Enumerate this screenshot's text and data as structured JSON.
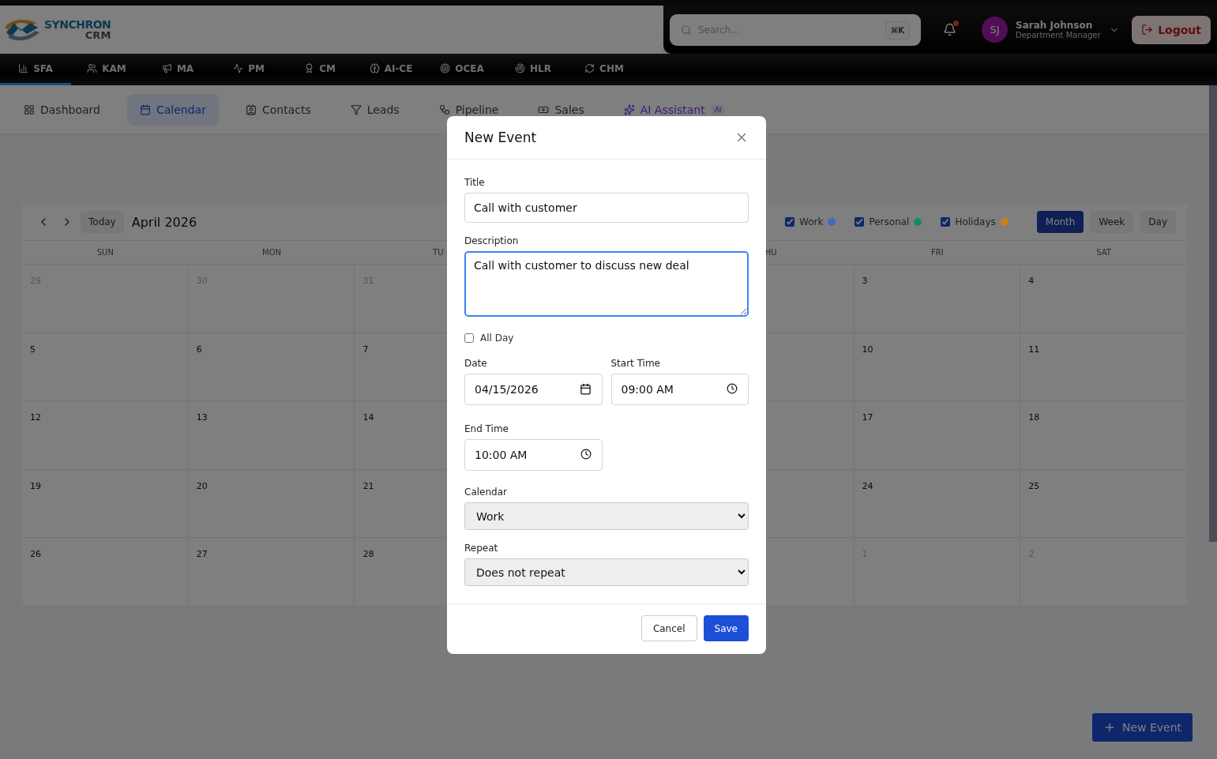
{
  "header": {
    "logo": {
      "name": "SYNCHRON",
      "sub": "CRM"
    },
    "search": {
      "placeholder": "Search...",
      "shortcut": "⌘K"
    },
    "notifications": {
      "unread": true
    },
    "user": {
      "initials": "SJ",
      "name": "Sarah Johnson",
      "role": "Department Manager"
    },
    "logout": "Logout"
  },
  "modules": [
    {
      "label": "SFA",
      "selected": true
    },
    {
      "label": "KAM",
      "selected": false
    },
    {
      "label": "MA",
      "selected": false
    },
    {
      "label": "PM",
      "selected": false
    },
    {
      "label": "CM",
      "selected": false
    },
    {
      "label": "AI-CE",
      "selected": false
    },
    {
      "label": "OCEA",
      "selected": false
    },
    {
      "label": "HLR",
      "selected": false
    },
    {
      "label": "CHM",
      "selected": false
    }
  ],
  "tabs": [
    {
      "label": "Dashboard",
      "selected": false
    },
    {
      "label": "Calendar",
      "selected": true
    },
    {
      "label": "Contacts",
      "selected": false
    },
    {
      "label": "Leads",
      "selected": false
    },
    {
      "label": "Pipeline",
      "selected": false
    },
    {
      "label": "Sales",
      "selected": false
    },
    {
      "label": "AI Assistant",
      "selected": false,
      "badge": "AI"
    }
  ],
  "calendar": {
    "today": "Today",
    "month": "April 2026",
    "filters": [
      {
        "label": "Work",
        "checked": true,
        "color": "#3a6cc0"
      },
      {
        "label": "Personal",
        "checked": true,
        "color": "#1a8a5a"
      },
      {
        "label": "Holidays",
        "checked": true,
        "color": "#c8821a"
      }
    ],
    "views": [
      {
        "label": "Month",
        "selected": true
      },
      {
        "label": "Week",
        "selected": false
      },
      {
        "label": "Day",
        "selected": false
      }
    ],
    "columns": [
      "SUN",
      "MON",
      "TU",
      "HU",
      "FRI",
      "SAT"
    ],
    "weeks": [
      {
        "days": [
          {
            "day": "29",
            "muted": true
          },
          {
            "day": "30",
            "muted": true
          },
          {
            "day": "31",
            "muted": true
          },
          {
            "day": "3",
            "muted": false
          },
          {
            "day": "4",
            "muted": false
          }
        ]
      },
      {
        "days": [
          {
            "day": "5",
            "muted": false
          },
          {
            "day": "6",
            "muted": false
          },
          {
            "day": "7",
            "muted": false
          },
          {
            "day": "10",
            "muted": false
          },
          {
            "day": "11",
            "muted": false
          }
        ]
      },
      {
        "days": [
          {
            "day": "12",
            "muted": false
          },
          {
            "day": "13",
            "muted": false
          },
          {
            "day": "14",
            "muted": false
          },
          {
            "day": "17",
            "muted": false
          },
          {
            "day": "18",
            "muted": false
          }
        ]
      },
      {
        "days": [
          {
            "day": "19",
            "muted": false
          },
          {
            "day": "20",
            "muted": false
          },
          {
            "day": "21",
            "muted": false
          },
          {
            "day": "24",
            "muted": false
          },
          {
            "day": "25",
            "muted": false
          }
        ]
      },
      {
        "days": [
          {
            "day": "26",
            "muted": false
          },
          {
            "day": "27",
            "muted": false
          },
          {
            "day": "28",
            "muted": false
          },
          {
            "day": "1",
            "muted": true
          },
          {
            "day": "2",
            "muted": true
          }
        ]
      }
    ]
  },
  "new_event_button": "New Event",
  "dialog": {
    "title": "New Event",
    "title_label": "Title",
    "title_value": "Call with customer",
    "description_label": "Description",
    "description_value": "Call with customer to discuss new deal",
    "all_day": {
      "label": "All Day",
      "checked": false
    },
    "date_label": "Date",
    "date_value": "04/15/2026",
    "start_label": "Start Time",
    "start_value": "09:00 AM",
    "end_label": "End Time",
    "end_value": "10:00 AM",
    "calendar_label": "Calendar",
    "calendar_value": "Work",
    "repeat_label": "Repeat",
    "repeat_value": "Does not repeat",
    "cancel": "Cancel",
    "save": "Save"
  }
}
